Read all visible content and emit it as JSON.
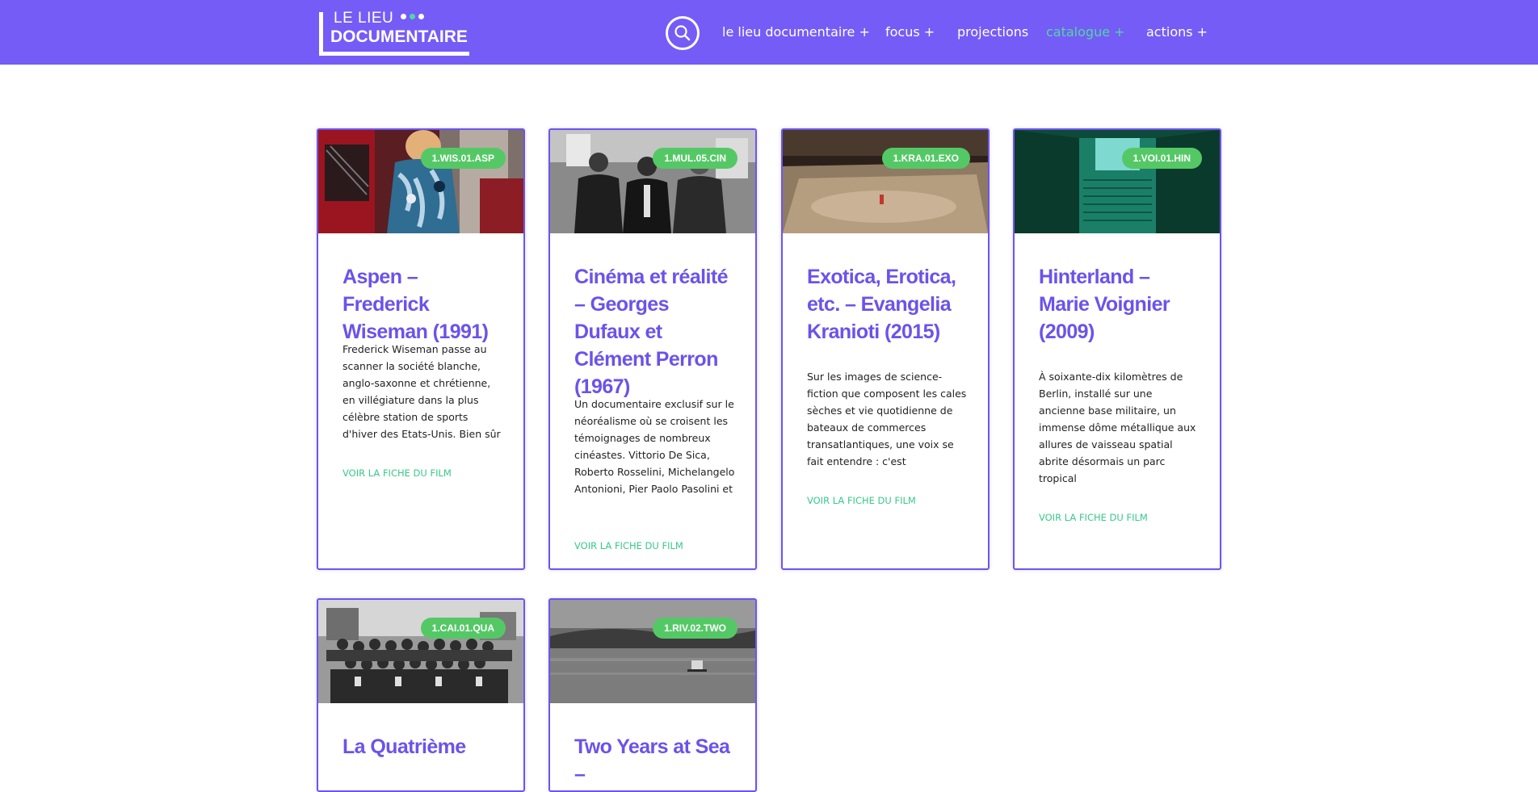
{
  "header": {
    "logo_line1": "LE LIEU",
    "logo_line2": "DOCUMENTAIRE",
    "nav": [
      {
        "label": "le lieu documentaire +",
        "active": false
      },
      {
        "label": "focus +",
        "active": false
      },
      {
        "label": "projections",
        "active": false
      },
      {
        "label": "catalogue +",
        "active": true
      },
      {
        "label": "actions +",
        "active": false
      }
    ],
    "search_icon": "search-icon"
  },
  "colors": {
    "brand_purple": "#755cf7",
    "title_purple": "#6b53ea",
    "active_green": "#4fd7a0",
    "badge_green": "#55c866",
    "link_green": "#38c98a"
  },
  "cards": [
    {
      "badge": "1.WIS.01.ASP",
      "title": "Aspen – Frederick Wiseman (1991)",
      "description": "Frederick Wiseman passe au scanner la société blanche, anglo-saxonne et chrétienne, en villégiature dans la plus célèbre station de sports d'hiver des Etats-Unis. Bien sûr",
      "link": "VOIR LA FICHE DU FILM"
    },
    {
      "badge": "1.MUL.05.CIN",
      "title": "Cinéma et réalité – Georges Dufaux et Clément Perron (1967)",
      "description": "Un documentaire exclusif sur le néoréalisme où se croisent les témoignages de nombreux cinéastes. Vittorio De Sica, Roberto Rosselini, Michelangelo Antonioni, Pier Paolo Pasolini et",
      "link": "VOIR LA FICHE DU FILM"
    },
    {
      "badge": "1.KRA.01.EXO",
      "title": "Exotica, Erotica, etc. – Evangelia Kranioti (2015)",
      "description": "Sur les images de science-fiction que composent les cales sèches et vie quotidienne de bateaux de commerces transatlantiques, une voix se fait entendre : c'est",
      "link": "VOIR LA FICHE DU FILM"
    },
    {
      "badge": "1.VOI.01.HIN",
      "title": "Hinterland – Marie Voignier (2009)",
      "description": "À soixante-dix kilomètres de Berlin, installé sur une ancienne base militaire, un immense dôme métallique aux allures de vaisseau spatial abrite désormais un parc tropical",
      "link": "VOIR LA FICHE DU FILM"
    },
    {
      "badge": "1.CAI.01.QUA",
      "title": "La Quatrième",
      "description": "",
      "link": ""
    },
    {
      "badge": "1.RIV.02.TWO",
      "title": "Two Years at Sea –",
      "description": "",
      "link": ""
    }
  ]
}
